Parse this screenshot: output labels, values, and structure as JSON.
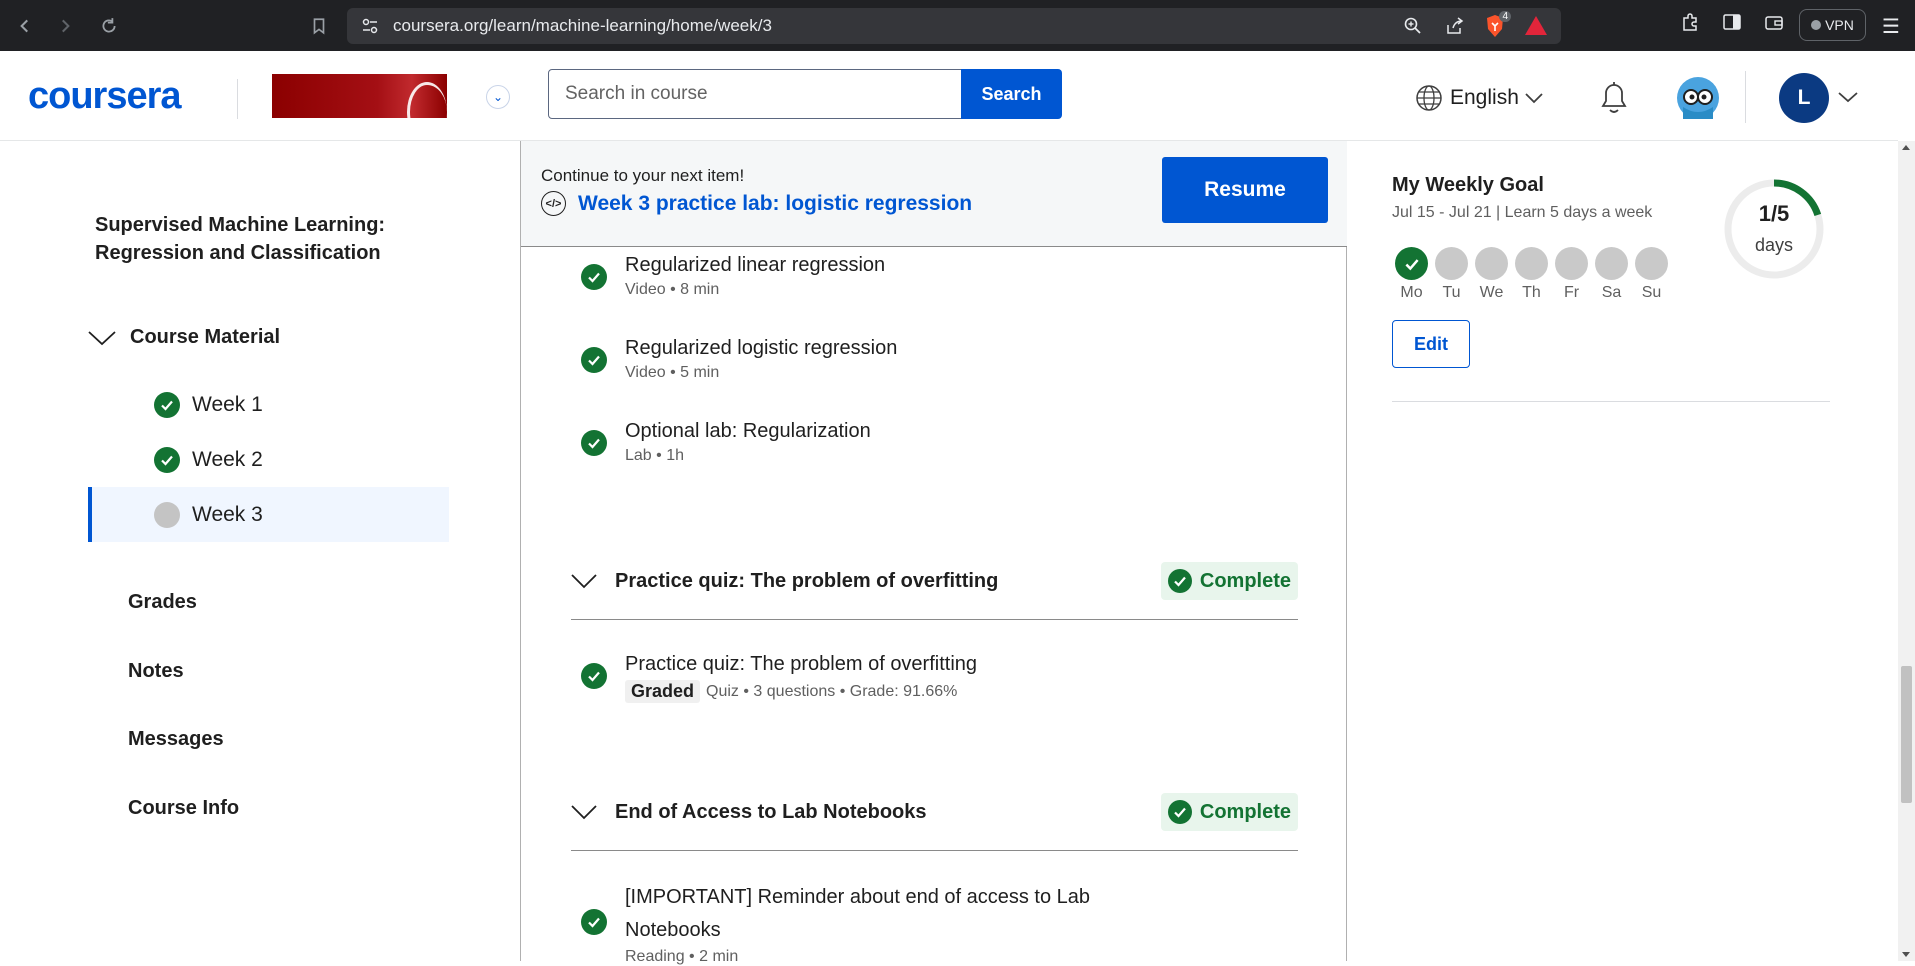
{
  "browser": {
    "url": "coursera.org/learn/machine-learning/home/week/3",
    "brave_badge": "4",
    "vpn_label": "VPN"
  },
  "header": {
    "logo": "coursera",
    "search_placeholder": "Search in course",
    "search_button": "Search",
    "language": "English",
    "avatar_initial": "L"
  },
  "sidebar": {
    "course_title": "Supervised Machine Learning: Regression and Classification",
    "section_label": "Course Material",
    "weeks": [
      {
        "label": "Week 1",
        "status": "complete"
      },
      {
        "label": "Week 2",
        "status": "complete"
      },
      {
        "label": "Week 3",
        "status": "in-progress"
      }
    ],
    "links": [
      "Grades",
      "Notes",
      "Messages",
      "Course Info"
    ]
  },
  "continue": {
    "label": "Continue to your next item!",
    "next_item": "Week 3 practice lab: logistic regression",
    "resume_button": "Resume"
  },
  "items": [
    {
      "title": "Regularized linear regression",
      "meta": "Video • 8 min"
    },
    {
      "title": "Regularized logistic regression",
      "meta": "Video • 5 min"
    },
    {
      "title": "Optional lab: Regularization",
      "meta": "Lab • 1h"
    }
  ],
  "sections": [
    {
      "title": "Practice quiz: The problem of overfitting",
      "status": "Complete",
      "item_title": "Practice quiz: The problem of overfitting",
      "item_tag": "Graded",
      "item_meta": "Quiz • 3 questions • Grade: 91.66%"
    },
    {
      "title": "End of Access to Lab Notebooks",
      "status": "Complete",
      "item_title_line1": "[IMPORTANT] Reminder about end of access to Lab",
      "item_title_line2": "Notebooks",
      "item_meta": "Reading • 2 min"
    }
  ],
  "weekly_goal": {
    "title": "My Weekly Goal",
    "subtitle": "Jul 15 - Jul 21 | Learn 5 days a week",
    "days": [
      {
        "label": "Mo",
        "done": true
      },
      {
        "label": "Tu",
        "done": false
      },
      {
        "label": "We",
        "done": false
      },
      {
        "label": "Th",
        "done": false
      },
      {
        "label": "Fr",
        "done": false
      },
      {
        "label": "Sa",
        "done": false
      },
      {
        "label": "Su",
        "done": false
      }
    ],
    "progress_value": "1/5",
    "progress_unit": "days",
    "progress_fraction": 0.2,
    "edit_button": "Edit"
  },
  "colors": {
    "brand_blue": "#0056d2",
    "complete_green": "#137333",
    "pending_gray": "#c4c4c4"
  }
}
